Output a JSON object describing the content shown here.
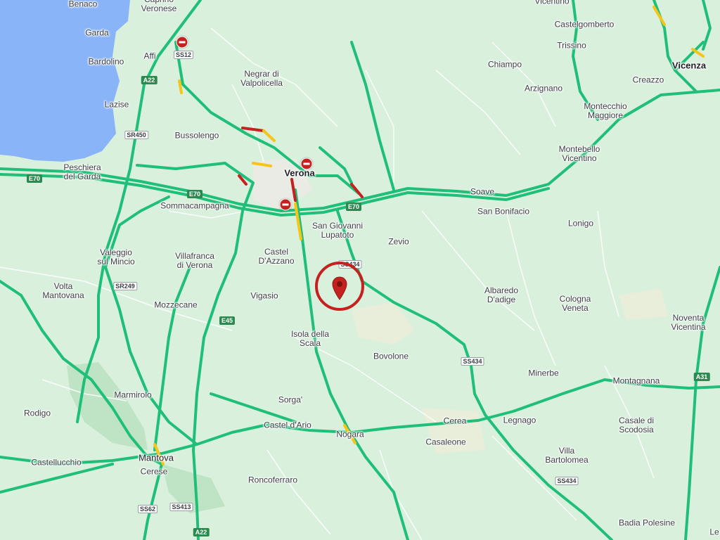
{
  "places": [
    {
      "name": "Benaco",
      "cls": ""
    },
    {
      "name": "Caprino\nVeronese",
      "cls": ""
    },
    {
      "name": "Garda",
      "cls": ""
    },
    {
      "name": "Affi",
      "cls": ""
    },
    {
      "name": "Bardolino",
      "cls": ""
    },
    {
      "name": "Lazise",
      "cls": ""
    },
    {
      "name": "Negrar di\nValpolicella",
      "cls": ""
    },
    {
      "name": "Bussolengo",
      "cls": ""
    },
    {
      "name": "Peschiera\ndel Garda",
      "cls": ""
    },
    {
      "name": "Verona",
      "cls": "major"
    },
    {
      "name": "Sommacampagna",
      "cls": ""
    },
    {
      "name": "San Giovanni\nLupatoto",
      "cls": ""
    },
    {
      "name": "Castel\nD'Azzano",
      "cls": ""
    },
    {
      "name": "Villafranca\ndi Verona",
      "cls": ""
    },
    {
      "name": "Valeggio\nsul Mincio",
      "cls": ""
    },
    {
      "name": "Volta\nMantovana",
      "cls": ""
    },
    {
      "name": "Mozzecane",
      "cls": ""
    },
    {
      "name": "Vigasio",
      "cls": ""
    },
    {
      "name": "Isola della\nScala",
      "cls": ""
    },
    {
      "name": "Zevio",
      "cls": ""
    },
    {
      "name": "Bovolone",
      "cls": ""
    },
    {
      "name": "Albaredo\nD'adige",
      "cls": ""
    },
    {
      "name": "Cologna\nVeneta",
      "cls": ""
    },
    {
      "name": "Noventa\nVicentina",
      "cls": ""
    },
    {
      "name": "Minerbe",
      "cls": ""
    },
    {
      "name": "Montagnana",
      "cls": ""
    },
    {
      "name": "Legnago",
      "cls": ""
    },
    {
      "name": "Cerea",
      "cls": ""
    },
    {
      "name": "Casaleone",
      "cls": ""
    },
    {
      "name": "Nogara",
      "cls": ""
    },
    {
      "name": "Castel d'Ario",
      "cls": ""
    },
    {
      "name": "Sorga'",
      "cls": ""
    },
    {
      "name": "Marmirolo",
      "cls": ""
    },
    {
      "name": "Rodigo",
      "cls": ""
    },
    {
      "name": "Castellucchio",
      "cls": ""
    },
    {
      "name": "Mantova",
      "cls": "city"
    },
    {
      "name": "Cerese",
      "cls": ""
    },
    {
      "name": "Roncoferraro",
      "cls": ""
    },
    {
      "name": "Villa\nBartolomea",
      "cls": ""
    },
    {
      "name": "Casale di\nScodosia",
      "cls": ""
    },
    {
      "name": "Badia Polesine",
      "cls": ""
    },
    {
      "name": "Soave",
      "cls": ""
    },
    {
      "name": "San Bonifacio",
      "cls": ""
    },
    {
      "name": "Lonigo",
      "cls": ""
    },
    {
      "name": "Montebello\nVicentino",
      "cls": ""
    },
    {
      "name": "Montecchio\nMaggiore",
      "cls": ""
    },
    {
      "name": "Creazzo",
      "cls": ""
    },
    {
      "name": "Vicenza",
      "cls": "major"
    },
    {
      "name": "Arzignano",
      "cls": ""
    },
    {
      "name": "Chiampo",
      "cls": ""
    },
    {
      "name": "Trissino",
      "cls": ""
    },
    {
      "name": "Castelgomberto",
      "cls": ""
    },
    {
      "name": "Vicentino",
      "cls": ""
    },
    {
      "name": "Le",
      "cls": ""
    }
  ],
  "shields": [
    {
      "name": "SS12",
      "cls": ""
    },
    {
      "name": "A22",
      "cls": "auto"
    },
    {
      "name": "SR450",
      "cls": ""
    },
    {
      "name": "E70",
      "cls": "euro"
    },
    {
      "name": "E70",
      "cls": "euro"
    },
    {
      "name": "E70",
      "cls": "euro"
    },
    {
      "name": "SR249",
      "cls": ""
    },
    {
      "name": "E45",
      "cls": "euro"
    },
    {
      "name": "SS434",
      "cls": ""
    },
    {
      "name": "SS434",
      "cls": ""
    },
    {
      "name": "SS434",
      "cls": ""
    },
    {
      "name": "A31",
      "cls": "auto"
    },
    {
      "name": "SS62",
      "cls": ""
    },
    {
      "name": "SS413",
      "cls": ""
    },
    {
      "name": "A22",
      "cls": "auto"
    }
  ],
  "colors": {
    "land": "#d9f0dd",
    "water": "#8ab4f8",
    "road_main": "#1fbf7a",
    "road_minor": "#ffffff",
    "traffic_slow": "#f5c518",
    "traffic_jam": "#c5221f",
    "marker": "#c5221f"
  },
  "icons": {
    "closure": "no-entry-icon",
    "location": "map-pin-icon"
  }
}
